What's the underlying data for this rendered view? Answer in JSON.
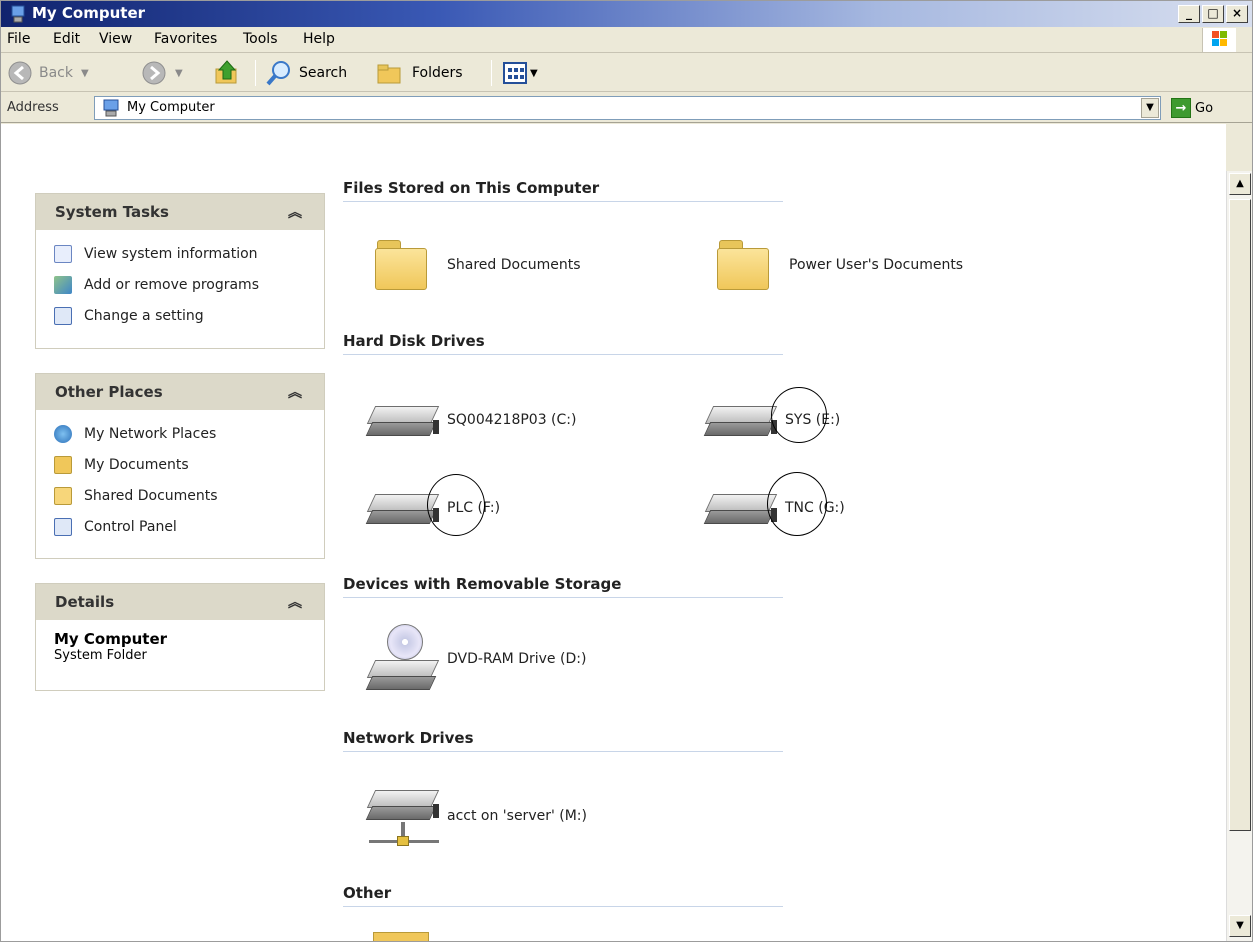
{
  "window": {
    "title": "My Computer"
  },
  "menu": {
    "items": [
      {
        "label": "File"
      },
      {
        "label": "Edit"
      },
      {
        "label": "View"
      },
      {
        "label": "Favorites"
      },
      {
        "label": "Tools"
      },
      {
        "label": "Help"
      }
    ]
  },
  "toolbar": {
    "back_label": "Back",
    "search_label": "Search",
    "folders_label": "Folders"
  },
  "address": {
    "label": "Address",
    "value": "My Computer",
    "go_label": "Go"
  },
  "left_pane": {
    "system_tasks": {
      "title": "System Tasks",
      "items": [
        {
          "label": "View system information",
          "icon": "system-info-icon"
        },
        {
          "label": "Add or remove programs",
          "icon": "add-remove-icon"
        },
        {
          "label": "Change a setting",
          "icon": "control-panel-icon"
        }
      ]
    },
    "other_places": {
      "title": "Other Places",
      "items": [
        {
          "label": "My Network Places",
          "icon": "network-icon"
        },
        {
          "label": "My Documents",
          "icon": "documents-icon"
        },
        {
          "label": "Shared Documents",
          "icon": "folder-icon"
        },
        {
          "label": "Control Panel",
          "icon": "control-panel-icon"
        }
      ]
    },
    "details": {
      "title": "Details",
      "name": "My Computer",
      "type": "System Folder"
    }
  },
  "main": {
    "groups": [
      {
        "title": "Files Stored on This Computer",
        "items": [
          {
            "label": "Shared Documents",
            "icon": "folder-icon"
          },
          {
            "label": "Power User's Documents",
            "icon": "folder-icon"
          }
        ]
      },
      {
        "title": "Hard Disk Drives",
        "items": [
          {
            "label": "SQ004218P03 (C:)",
            "icon": "hard-drive-icon"
          },
          {
            "label": "SYS (E:)",
            "icon": "hard-drive-icon"
          },
          {
            "label": "PLC (F:)",
            "icon": "hard-drive-icon"
          },
          {
            "label": "TNC (G:)",
            "icon": "hard-drive-icon"
          }
        ]
      },
      {
        "title": "Devices with Removable Storage",
        "items": [
          {
            "label": "DVD-RAM Drive (D:)",
            "icon": "dvd-drive-icon"
          }
        ]
      },
      {
        "title": "Network Drives",
        "items": [
          {
            "label": "acct on 'server' (M:)",
            "icon": "network-drive-icon"
          }
        ]
      },
      {
        "title": "Other",
        "items": []
      }
    ]
  }
}
